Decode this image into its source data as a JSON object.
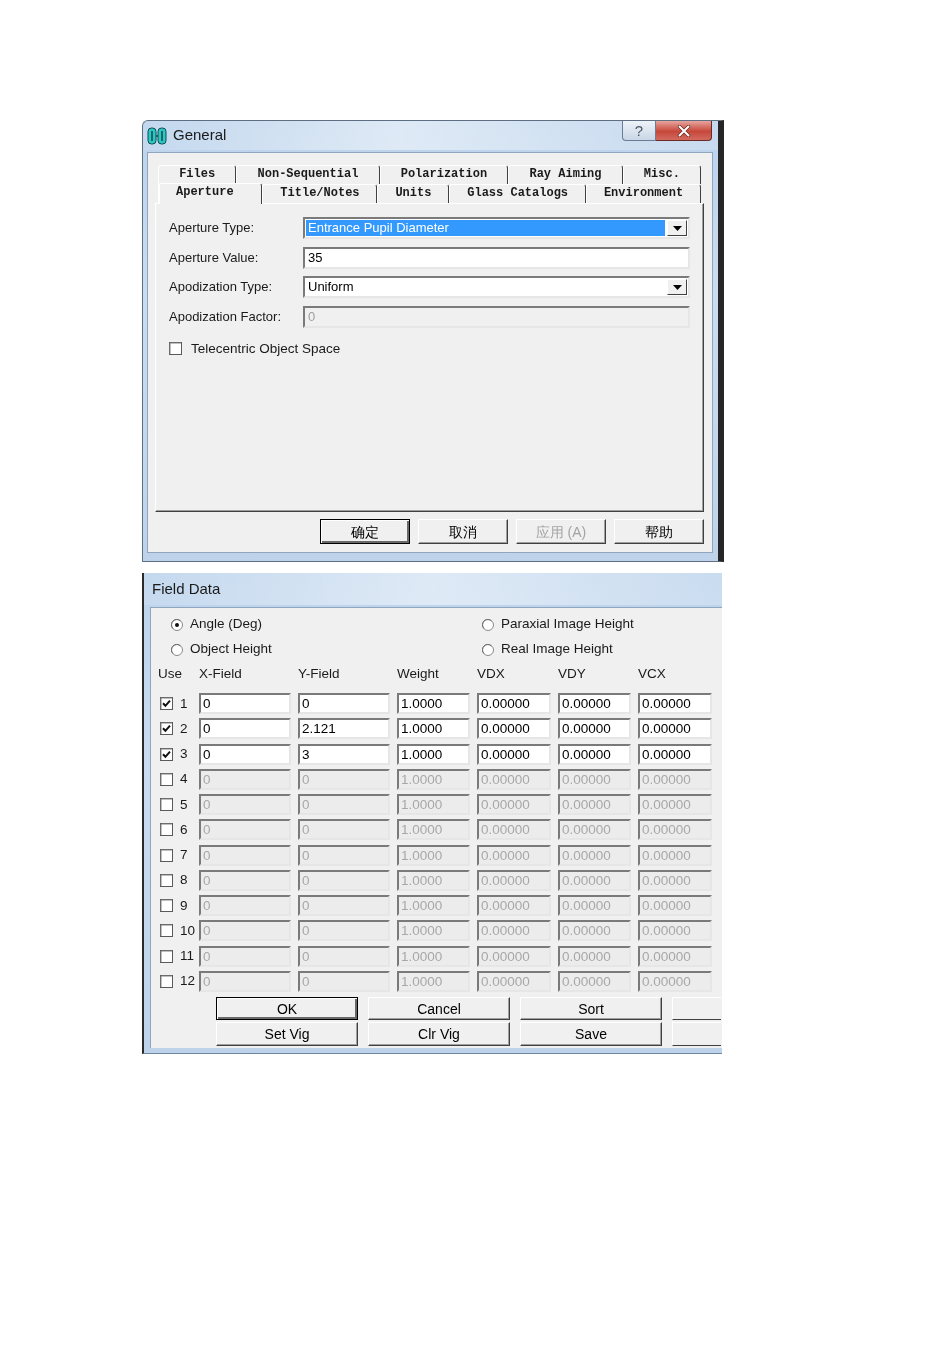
{
  "general_dialog": {
    "title": "General",
    "help_label": "?",
    "tab_rows": [
      [
        {
          "label": "Files",
          "selected": false
        },
        {
          "label": "Non-Sequential",
          "selected": false
        },
        {
          "label": "Polarization",
          "selected": false
        },
        {
          "label": "Ray Aiming",
          "selected": false
        },
        {
          "label": "Misc.",
          "selected": false
        }
      ],
      [
        {
          "label": "Aperture",
          "selected": true
        },
        {
          "label": "Title/Notes",
          "selected": false
        },
        {
          "label": "Units",
          "selected": false
        },
        {
          "label": "Glass Catalogs",
          "selected": false
        },
        {
          "label": "Environment",
          "selected": false
        }
      ]
    ],
    "fields": [
      {
        "kind": "dropdown",
        "label": "Aperture Type:",
        "value": "Entrance Pupil Diameter",
        "highlighted": true,
        "disabled": false
      },
      {
        "kind": "text",
        "label": "Aperture Value:",
        "value": "35",
        "highlighted": false,
        "disabled": false
      },
      {
        "kind": "dropdown",
        "label": "Apodization Type:",
        "value": "Uniform",
        "highlighted": false,
        "disabled": false
      },
      {
        "kind": "text",
        "label": "Apodization Factor:",
        "value": "0",
        "highlighted": false,
        "disabled": true
      }
    ],
    "checkbox": {
      "label": "Telecentric Object Space",
      "checked": false
    },
    "buttons": [
      {
        "label": "确定",
        "default": true,
        "disabled": false
      },
      {
        "label": "取消",
        "default": false,
        "disabled": false
      },
      {
        "label": "应用 (A)",
        "default": false,
        "disabled": true
      },
      {
        "label": "帮助",
        "default": false,
        "disabled": false
      }
    ]
  },
  "field_data_dialog": {
    "title": "Field Data",
    "field_types": [
      {
        "label": "Angle (Deg)",
        "selected": true
      },
      {
        "label": "Paraxial Image Height",
        "selected": false
      },
      {
        "label": "Object Height",
        "selected": false
      },
      {
        "label": "Real Image Height",
        "selected": false
      }
    ],
    "columns": [
      "Use",
      "X-Field",
      "Y-Field",
      "Weight",
      "VDX",
      "VDY",
      "VCX"
    ],
    "rows": [
      {
        "number": "1",
        "checked": true,
        "values": [
          "0",
          "0",
          "1.0000",
          "0.00000",
          "0.00000",
          "0.00000"
        ]
      },
      {
        "number": "2",
        "checked": true,
        "values": [
          "0",
          "2.121",
          "1.0000",
          "0.00000",
          "0.00000",
          "0.00000"
        ]
      },
      {
        "number": "3",
        "checked": true,
        "values": [
          "0",
          "3",
          "1.0000",
          "0.00000",
          "0.00000",
          "0.00000"
        ]
      },
      {
        "number": "4",
        "checked": false,
        "values": [
          "0",
          "0",
          "1.0000",
          "0.00000",
          "0.00000",
          "0.00000"
        ]
      },
      {
        "number": "5",
        "checked": false,
        "values": [
          "0",
          "0",
          "1.0000",
          "0.00000",
          "0.00000",
          "0.00000"
        ]
      },
      {
        "number": "6",
        "checked": false,
        "values": [
          "0",
          "0",
          "1.0000",
          "0.00000",
          "0.00000",
          "0.00000"
        ]
      },
      {
        "number": "7",
        "checked": false,
        "values": [
          "0",
          "0",
          "1.0000",
          "0.00000",
          "0.00000",
          "0.00000"
        ]
      },
      {
        "number": "8",
        "checked": false,
        "values": [
          "0",
          "0",
          "1.0000",
          "0.00000",
          "0.00000",
          "0.00000"
        ]
      },
      {
        "number": "9",
        "checked": false,
        "values": [
          "0",
          "0",
          "1.0000",
          "0.00000",
          "0.00000",
          "0.00000"
        ]
      },
      {
        "number": "10",
        "checked": false,
        "values": [
          "0",
          "0",
          "1.0000",
          "0.00000",
          "0.00000",
          "0.00000"
        ]
      },
      {
        "number": "11",
        "checked": false,
        "values": [
          "0",
          "0",
          "1.0000",
          "0.00000",
          "0.00000",
          "0.00000"
        ]
      },
      {
        "number": "12",
        "checked": false,
        "values": [
          "0",
          "0",
          "1.0000",
          "0.00000",
          "0.00000",
          "0.00000"
        ]
      }
    ],
    "button_rows": [
      [
        {
          "kind": "labeled",
          "label": "OK",
          "default": true
        },
        {
          "kind": "labeled",
          "label": "Cancel",
          "default": false
        },
        {
          "kind": "labeled",
          "label": "Sort",
          "default": false
        },
        {
          "kind": "clipped",
          "default": false
        }
      ],
      [
        {
          "kind": "labeled",
          "label": "Set Vig",
          "default": false
        },
        {
          "kind": "labeled",
          "label": "Clr Vig",
          "default": false
        },
        {
          "kind": "labeled",
          "label": "Save",
          "default": false
        },
        {
          "kind": "clipped",
          "default": false
        }
      ]
    ]
  }
}
